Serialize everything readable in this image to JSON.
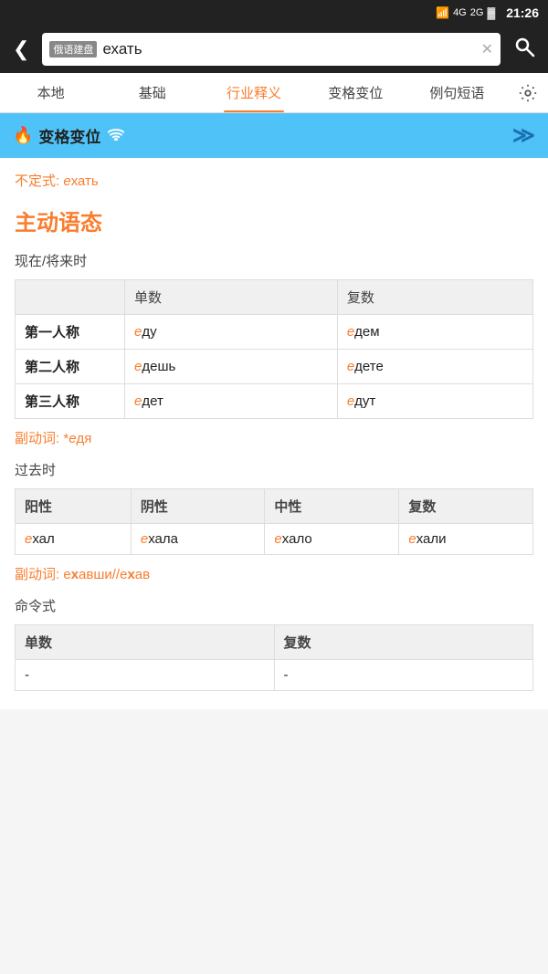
{
  "statusBar": {
    "time": "21:26",
    "icons": "4G 2G battery"
  },
  "navBar": {
    "searchPlaceholder": "ехать",
    "dictBadge": "俄语建盘",
    "searchValue": "ехать"
  },
  "tabs": [
    {
      "id": "local",
      "label": "本地",
      "active": false
    },
    {
      "id": "basic",
      "label": "基础",
      "active": false
    },
    {
      "id": "industry",
      "label": "行业释义",
      "active": true
    },
    {
      "id": "conjugation",
      "label": "变格变位",
      "active": false
    },
    {
      "id": "examples",
      "label": "例句短语",
      "active": false
    }
  ],
  "sectionHeader": {
    "icon": "🔥",
    "title": "变格变位",
    "wifiIcon": "≋",
    "chevron": "≫"
  },
  "infinitive": {
    "label": "不定式:",
    "highlightPart": "е",
    "normalPart": "хать"
  },
  "voiceTitle": "主动语态",
  "presentTense": {
    "label": "现在/将来时",
    "headers": [
      "",
      "单数",
      "复数"
    ],
    "rows": [
      {
        "person": "第一人称",
        "singular": {
          "highlight": "е",
          "rest": "ду"
        },
        "plural": {
          "highlight": "е",
          "rest": "дем"
        }
      },
      {
        "person": "第二人称",
        "singular": {
          "highlight": "е",
          "rest": "дешь"
        },
        "plural": {
          "highlight": "е",
          "rest": "дете"
        }
      },
      {
        "person": "第三人称",
        "singular": {
          "highlight": "е",
          "rest": "дет"
        },
        "plural": {
          "highlight": "е",
          "rest": "дут"
        }
      }
    ],
    "participle": "副动词: *едя"
  },
  "pastTense": {
    "label": "过去时",
    "headers": [
      "阳性",
      "阴性",
      "中性",
      "复数"
    ],
    "rows": [
      {
        "masc": {
          "highlight": "е",
          "rest": "хал"
        },
        "fem": {
          "highlight": "е",
          "rest": "хала"
        },
        "neut": {
          "highlight": "е",
          "rest": "хало"
        },
        "plur": {
          "highlight": "е",
          "rest": "хали"
        }
      }
    ],
    "participle": "副动词: eхавши//eхав"
  },
  "imperative": {
    "label": "命令式",
    "headers": [
      "单数",
      "复数"
    ],
    "rows": [
      {
        "singular": "-",
        "plural": "-"
      }
    ]
  }
}
